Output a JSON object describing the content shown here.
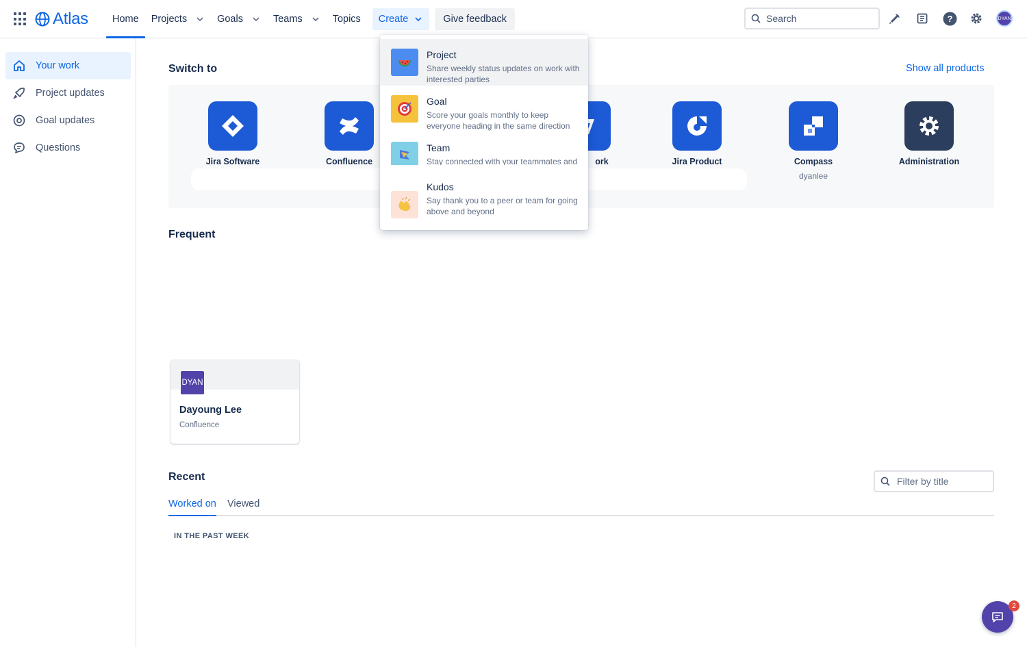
{
  "header": {
    "logo": "Atlas",
    "nav": [
      {
        "label": "Home"
      },
      {
        "label": "Projects"
      },
      {
        "label": "Goals"
      },
      {
        "label": "Teams"
      },
      {
        "label": "Topics"
      }
    ],
    "create_label": "Create",
    "feedback_label": "Give feedback",
    "search_placeholder": "Search",
    "avatar_initials": "DYAN"
  },
  "sidebar": {
    "items": [
      {
        "label": "Your work",
        "icon": "home-icon"
      },
      {
        "label": "Project updates",
        "icon": "rocket-icon"
      },
      {
        "label": "Goal updates",
        "icon": "target-icon"
      },
      {
        "label": "Questions",
        "icon": "chat-bubble-icon"
      }
    ]
  },
  "switch_to": {
    "title": "Switch to",
    "show_all": "Show all products",
    "products": [
      {
        "name": "Jira Software",
        "sub": "",
        "color": "#1d5ad6"
      },
      {
        "name": "Confluence",
        "sub": "",
        "color": "#1d5ad6"
      },
      {
        "name": "ork",
        "sub": "",
        "color": "#1d5ad6"
      },
      {
        "name": "Jira Product",
        "sub": "",
        "color": "#1d5ad6"
      },
      {
        "name": "Compass",
        "sub": "dyanlee",
        "color": "#1d5ad6"
      },
      {
        "name": "Administration",
        "sub": "",
        "color": "#2c3e5d"
      }
    ]
  },
  "create_menu": {
    "items": [
      {
        "title": "Project",
        "description": "Share weekly status updates on work with interested parties",
        "icon": "watermelon-icon"
      },
      {
        "title": "Goal",
        "description": "Score your goals monthly to keep everyone heading in the same direction",
        "icon": "dartboard-icon"
      },
      {
        "title": "Team",
        "description": "Stay connected with your teammates and get everyone working in one place",
        "icon": "team-flag-icon"
      },
      {
        "title": "Kudos",
        "description": "Say thank you to a peer or team for going above and beyond",
        "icon": "clapping-hands-icon"
      }
    ]
  },
  "frequent": {
    "title": "Frequent",
    "cards": [
      {
        "avatar": "DYAN",
        "name": "Dayoung Lee",
        "product": "Confluence"
      }
    ]
  },
  "recent": {
    "title": "Recent",
    "filter_placeholder": "Filter by title",
    "tabs": [
      {
        "label": "Worked on",
        "active": true
      },
      {
        "label": "Viewed",
        "active": false
      }
    ],
    "group_label": "IN THE PAST WEEK"
  },
  "chat": {
    "badge_count": "2"
  },
  "colors": {
    "accent": "#0c66e4",
    "avatar": "#5243aa",
    "badge": "#e2483d"
  }
}
